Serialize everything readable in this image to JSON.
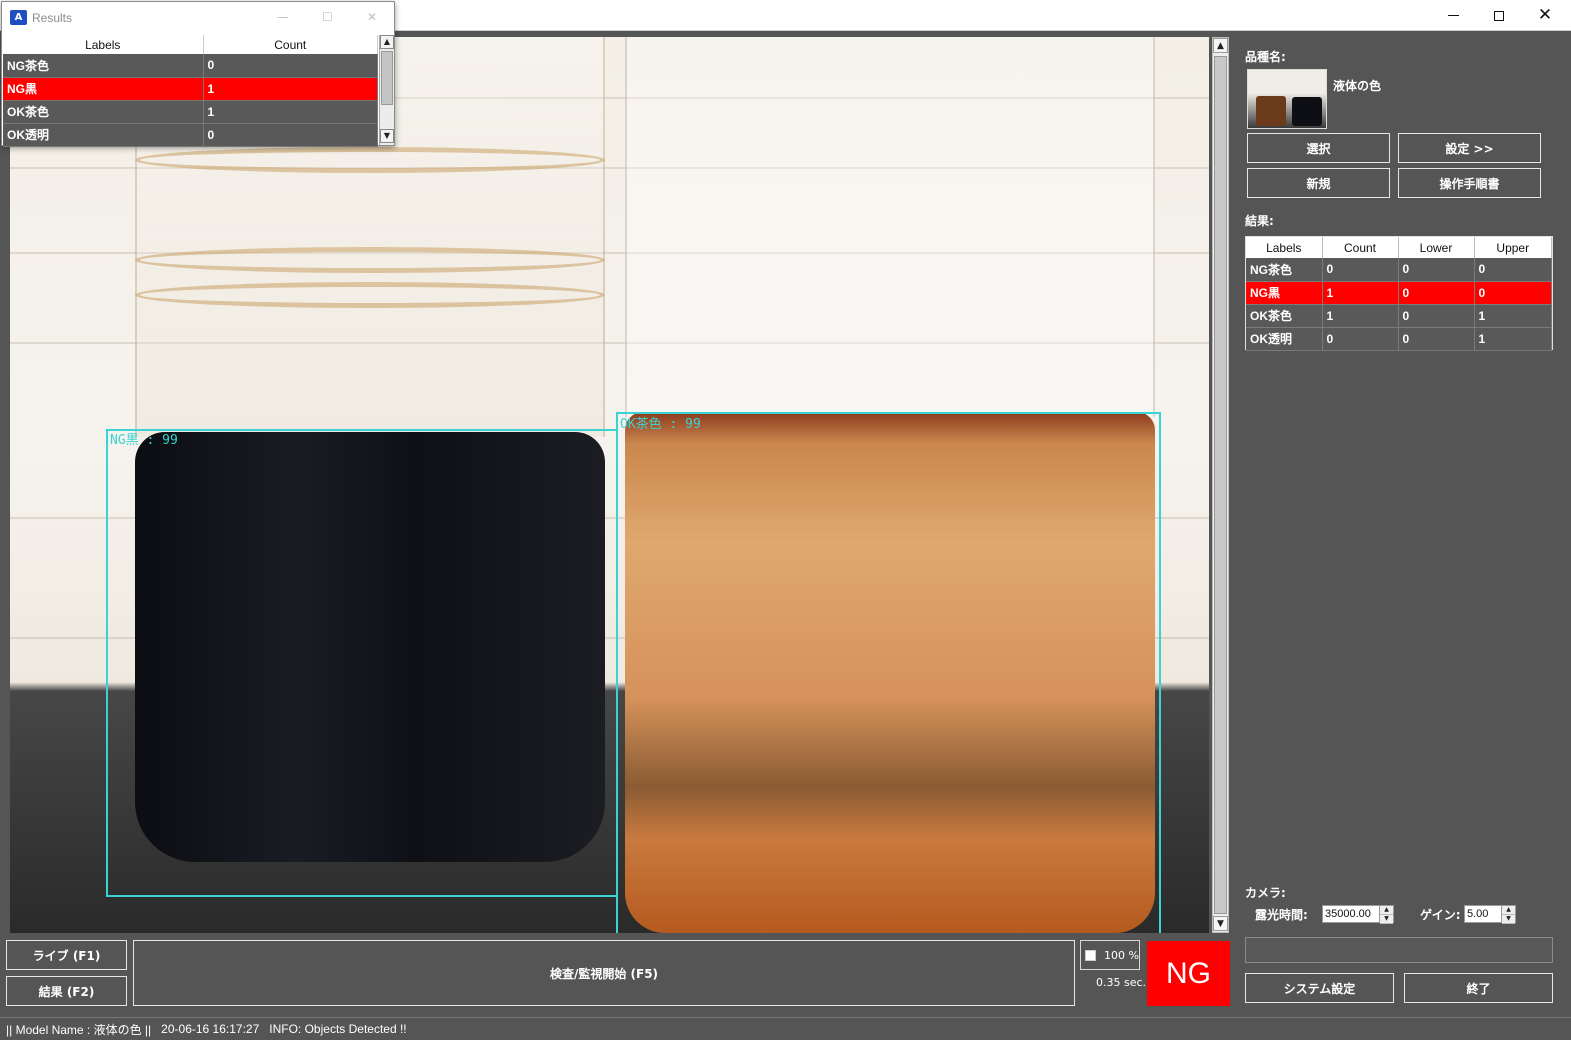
{
  "window": {
    "controls": {
      "minimize": "—",
      "maximize": "☐",
      "close": "✕"
    }
  },
  "floating_results": {
    "title": "Results",
    "columns": [
      "Labels",
      "Count"
    ],
    "rows": [
      {
        "label": "NG茶色",
        "count": "0",
        "selected": false
      },
      {
        "label": "NG黒",
        "count": "1",
        "selected": true
      },
      {
        "label": "OK茶色",
        "count": "1",
        "selected": false
      },
      {
        "label": "OK透明",
        "count": "0",
        "selected": false
      }
    ]
  },
  "viewer": {
    "detections": [
      {
        "text": "NG黒 : 99",
        "color": "#3ad3d3"
      },
      {
        "text": "OK茶色 : 99",
        "color": "#3ad3d3"
      }
    ]
  },
  "right_panel": {
    "product_label": "品種名:",
    "model_name": "液体の色",
    "buttons": {
      "select": "選択",
      "settings": "設定 >>",
      "new": "新規",
      "manual": "操作手順書"
    },
    "results_label": "結果:",
    "results_columns": [
      "Labels",
      "Count",
      "Lower",
      "Upper"
    ],
    "results_rows": [
      {
        "label": "NG茶色",
        "count": "0",
        "lower": "0",
        "upper": "0",
        "selected": false
      },
      {
        "label": "NG黒",
        "count": "1",
        "lower": "0",
        "upper": "0",
        "selected": true
      },
      {
        "label": "OK茶色",
        "count": "1",
        "lower": "0",
        "upper": "1",
        "selected": false
      },
      {
        "label": "OK透明",
        "count": "0",
        "lower": "0",
        "upper": "1",
        "selected": false
      }
    ],
    "camera_label": "カメラ:",
    "exposure_label": "露光時間:",
    "exposure_value": "35000.00",
    "gain_label": "ゲイン:",
    "gain_value": "5.00",
    "system_settings": "システム設定",
    "exit": "終了"
  },
  "bottom": {
    "live": "ライブ (F1)",
    "result": "結果 (F2)",
    "start_inspection": "検査/監視開始 (F5)",
    "zoom": "100 %",
    "elapsed": "0.35 sec.",
    "verdict": "NG",
    "verdict_color": "#ff0000"
  },
  "status": {
    "model": "|| Model Name : 液体の色 ||",
    "datetime": "20-06-16 16:17:27",
    "info": "INFO:  Objects Detected !!"
  }
}
